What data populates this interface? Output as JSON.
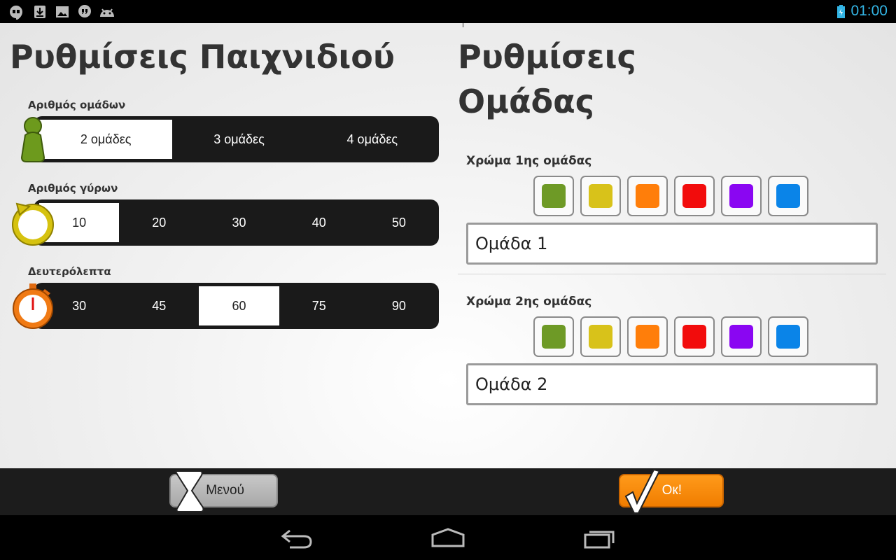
{
  "status_bar": {
    "time": "01:00"
  },
  "game_settings": {
    "title": "Ρυθμίσεις Παιχνιδιού",
    "teams": {
      "label": "Αριθμός ομάδων",
      "options": [
        "2 ομάδες",
        "3 ομάδες",
        "4 ομάδες"
      ],
      "selected": 0
    },
    "rounds": {
      "label": "Αριθμός γύρων",
      "options": [
        "10",
        "20",
        "30",
        "40",
        "50"
      ],
      "selected": 0
    },
    "seconds": {
      "label": "Δευτερόλεπτα",
      "options": [
        "30",
        "45",
        "60",
        "75",
        "90"
      ],
      "selected": 2
    }
  },
  "team_settings": {
    "title": "Ρυθμίσεις Ομάδας",
    "colors": [
      "#6e9a26",
      "#d8c21a",
      "#ff7e0a",
      "#f20c0c",
      "#8a06f2",
      "#0a84e8"
    ],
    "team1": {
      "color_label": "Χρώμα 1ης ομάδας",
      "name": "Ομάδα 1"
    },
    "team2": {
      "color_label": "Χρώμα 2ης ομάδας",
      "name": "Ομάδα 2"
    }
  },
  "actions": {
    "menu_label": "Μενού",
    "ok_label": "Ок!"
  },
  "icons": [
    "hangouts-icon",
    "download-icon",
    "image-icon",
    "quote-icon",
    "android-icon",
    "battery-icon",
    "player-pawn-icon",
    "cycle-icon",
    "stopwatch-icon",
    "hourglass-icon",
    "checkmark-icon",
    "back-icon",
    "home-icon",
    "recents-icon"
  ]
}
